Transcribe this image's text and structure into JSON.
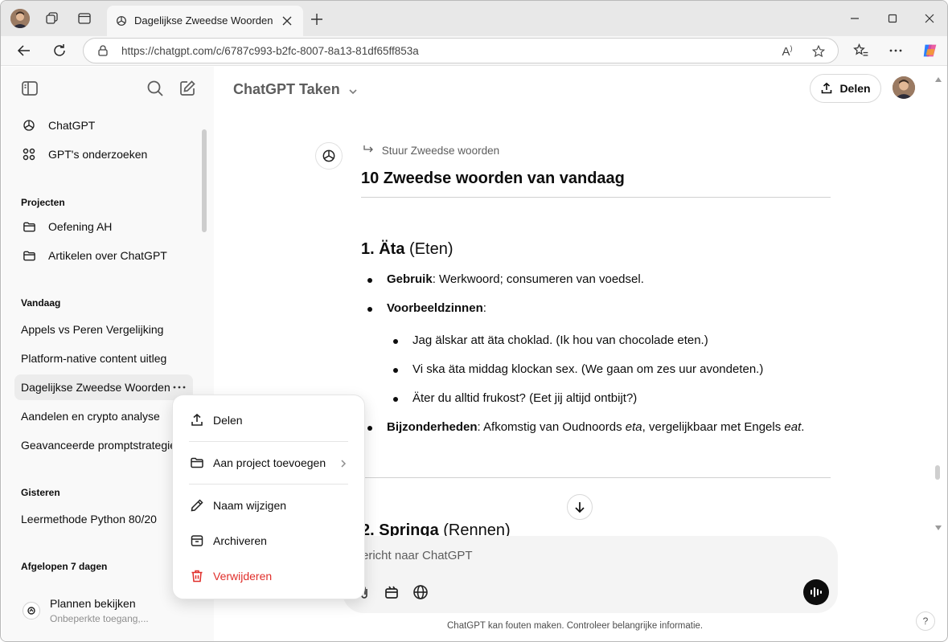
{
  "browser": {
    "tab_title": "Dagelijkse Zweedse Woorden",
    "url": "https://chatgpt.com/c/6787c993-b2fc-8007-8a13-81df65ff853a"
  },
  "sidebar": {
    "top_items": [
      {
        "label": "ChatGPT",
        "icon": "openai-logo-icon"
      },
      {
        "label": "GPT's onderzoeken",
        "icon": "grid-icon"
      }
    ],
    "projects_heading": "Projecten",
    "projects": [
      {
        "label": "Oefening AH"
      },
      {
        "label": "Artikelen over ChatGPT"
      }
    ],
    "today_heading": "Vandaag",
    "today": [
      {
        "label": "Appels vs Peren Vergelijking"
      },
      {
        "label": "Platform-native content uitleg"
      },
      {
        "label": "Dagelijkse Zweedse Woorden"
      },
      {
        "label": "Aandelen en crypto analyse"
      },
      {
        "label": "Geavanceerde promptstrategieën"
      }
    ],
    "yesterday_heading": "Gisteren",
    "yesterday": [
      {
        "label": "Leermethode Python 80/20"
      }
    ],
    "last7_heading": "Afgelopen 7 dagen",
    "plan_title": "Plannen bekijken",
    "plan_sub": "Onbeperkte toegang,..."
  },
  "header": {
    "model": "ChatGPT Taken",
    "share": "Delen"
  },
  "message": {
    "crumb": "Stuur Zweedse woorden",
    "heading": "10 Zweedse woorden van vandaag",
    "word1": {
      "number_word": "1. Äta",
      "translation": "(Eten)",
      "usage_label": "Gebruik",
      "usage_text": ": Werkwoord; consumeren van voedsel.",
      "examples_label": "Voorbeeldzinnen",
      "examples_colon": ":",
      "examples": [
        "Jag älskar att äta choklad. (Ik hou van chocolade eten.)",
        "Vi ska äta middag klockan sex. (We gaan om zes uur avondeten.)",
        "Äter du alltid frukost? (Eet jij altijd ontbijt?)"
      ],
      "details_label": "Bijzonderheden",
      "details_a": ": Afkomstig van Oudnoords ",
      "details_b": "eta",
      "details_c": ", vergelijkbaar met Engels ",
      "details_d": "eat",
      "details_e": "."
    },
    "word2": {
      "number_word": "2. Springa",
      "translation": "(Rennen)"
    }
  },
  "composer": {
    "placeholder": "ericht naar ChatGPT",
    "footnote": "ChatGPT kan fouten maken. Controleer belangrijke informatie.",
    "help": "?"
  },
  "context_menu": {
    "items": [
      {
        "label": "Delen",
        "icon": "share-icon"
      },
      {
        "label": "Aan project toevoegen",
        "icon": "folder-icon"
      },
      {
        "label": "Naam wijzigen",
        "icon": "pencil-icon"
      },
      {
        "label": "Archiveren",
        "icon": "archive-icon"
      },
      {
        "label": "Verwijderen",
        "icon": "trash-icon"
      }
    ],
    "danger_color": "#e02e2a"
  }
}
